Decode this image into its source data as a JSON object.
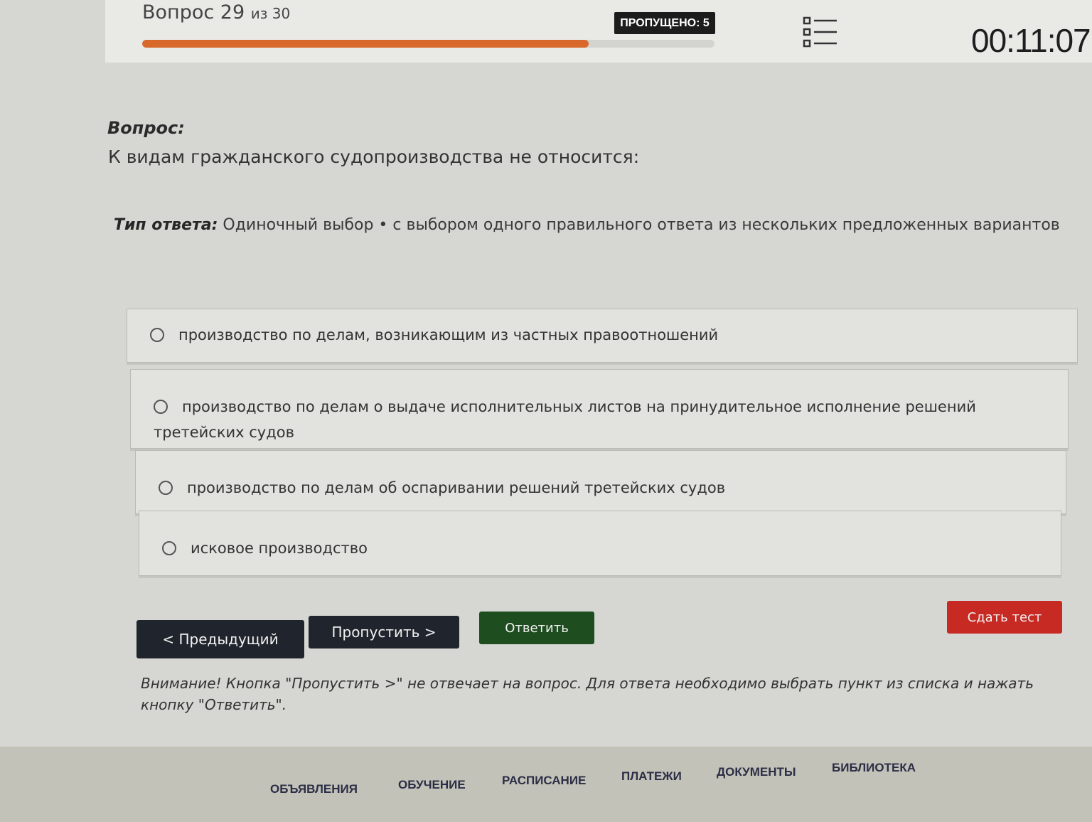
{
  "header": {
    "question_word": "Вопрос",
    "question_current": "29",
    "question_total_text": "из 30",
    "progress_percent": 78,
    "skipped_text": "ПРОПУЩЕНО: 5",
    "timer": "00:11:07"
  },
  "question": {
    "label": "Вопрос:",
    "text": "К видам гражданского судопроизводства не относится:"
  },
  "answer_type": {
    "label": "Тип ответа:",
    "text": "Одиночный выбор • с выбором одного правильного ответа из нескольких предложенных вариантов"
  },
  "options": [
    {
      "label": "производство по делам, возникающим из частных правоотношений"
    },
    {
      "label": "производство по делам о выдаче исполнительных листов на принудительное исполнение решений третейских судов"
    },
    {
      "label": "производство по делам об оспаривании решений третейских судов"
    },
    {
      "label": "исковое производство"
    }
  ],
  "buttons": {
    "prev": "< Предыдущий",
    "skip": "Пропустить >",
    "answer": "Ответить",
    "submit": "Сдать тест"
  },
  "warning": "Внимание! Кнопка \"Пропустить >\" не отвечает на вопрос. Для ответа необходимо выбрать пункт из списка и нажать кнопку \"Ответить\".",
  "footer_nav": [
    "ОБЪЯВЛЕНИЯ",
    "ОБУЧЕНИЕ",
    "РАСПИСАНИЕ",
    "ПЛАТЕЖИ",
    "ДОКУМЕНТЫ",
    "БИБЛИОТЕКА"
  ],
  "colors": {
    "progress": "#d9692a",
    "submit": "#c62a23",
    "answer": "#1e4d1f",
    "dark_button": "#20242c"
  },
  "icons": {
    "question_list": "list-icon",
    "option_marker": "radio-icon"
  }
}
